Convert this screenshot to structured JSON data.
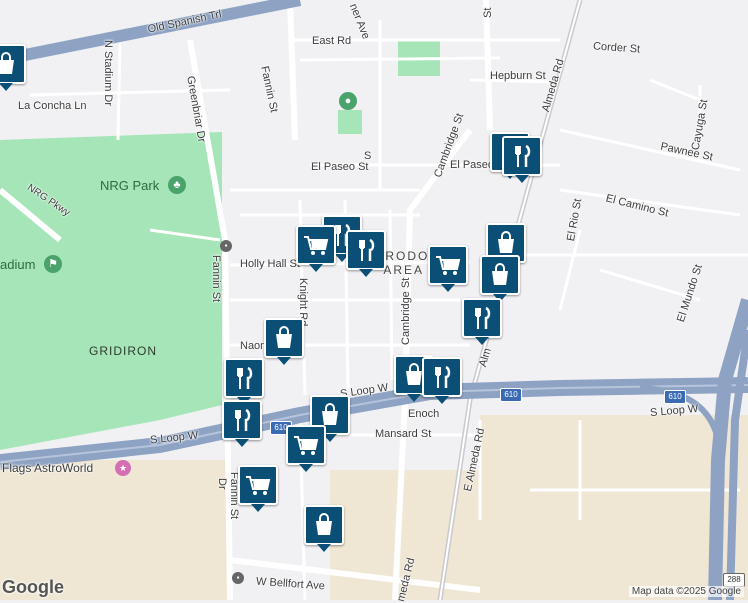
{
  "map": {
    "area_label_line1": "ASTRODOME",
    "area_label_line2": "AREA",
    "gridiron": "GRIDIRON",
    "park_name": "NRG Park",
    "stadium": "adium",
    "astroworld": "Flags AstroWorld",
    "streets": {
      "old_spanish": "Old Spanish Trl",
      "east_rd": "East Rd",
      "corder": "Corder St",
      "hepburn": "Hepburn St",
      "la_concha": "La Concha Ln",
      "n_stadium": "N Stadium Dr",
      "greenbriar": "Greenbriar Dr",
      "fannin_top": "Fannin St",
      "fannin_mid": "Fannin St",
      "fannin_bottom": "Fannin St",
      "el_paseo": "El Paseo St",
      "el_paseo_right": "El Paseo",
      "pawnee": "Pawnee St",
      "cayuga": "Cayuga St",
      "el_camino": "El Camino St",
      "el_rio": "El Rio St",
      "el_mundo": "El Mundo St",
      "holly_hall": "Holly Hall St",
      "knight": "Knight Rd",
      "cambridge_top": "Cambridge St",
      "cambridge_mid": "Cambridge St",
      "naomi": "Naomi",
      "s_loop_w_1": "S Loop W",
      "s_loop_w_2": "S Loop W",
      "s_loop_w_3": "S Loop W",
      "enoch": "Enoch",
      "mansard": "Mansard St",
      "almeda_top": "Almeda Rd",
      "almeda_mid": "Alm",
      "e_almeda": "E Almeda Rd",
      "almeda_bottom": "meda Rd",
      "w_bellfort": "W Bellfort Ave",
      "nrg_pkwy": "NRG Pkwy",
      "partial_ave": "ner Ave",
      "partial_sq": "S",
      "partial_st_top": "St",
      "partial_dr": "Dr"
    },
    "shields": {
      "i610_a": "610",
      "i610_b": "610",
      "i610_c": "610",
      "us288": "288"
    },
    "footer": {
      "logo": "Google",
      "attribution": "Map data ©2025 Google"
    },
    "colors": {
      "pin": "#0b4f77",
      "park": "#9fe0b3",
      "highway": "#8ea3c4",
      "industrial": "#efe6d3"
    },
    "pins": [
      {
        "type": "shopping-bag"
      },
      {
        "type": "restaurant"
      },
      {
        "type": "restaurant"
      },
      {
        "type": "restaurant"
      },
      {
        "type": "grocery-cart"
      },
      {
        "type": "restaurant"
      },
      {
        "type": "shopping-bag"
      },
      {
        "type": "grocery-cart"
      },
      {
        "type": "shopping-bag"
      },
      {
        "type": "restaurant"
      },
      {
        "type": "shopping-bag"
      },
      {
        "type": "shopping-bag"
      },
      {
        "type": "restaurant"
      },
      {
        "type": "restaurant"
      },
      {
        "type": "restaurant"
      },
      {
        "type": "shopping-bag"
      },
      {
        "type": "grocery-cart"
      },
      {
        "type": "grocery-cart"
      },
      {
        "type": "shopping-bag"
      }
    ]
  }
}
